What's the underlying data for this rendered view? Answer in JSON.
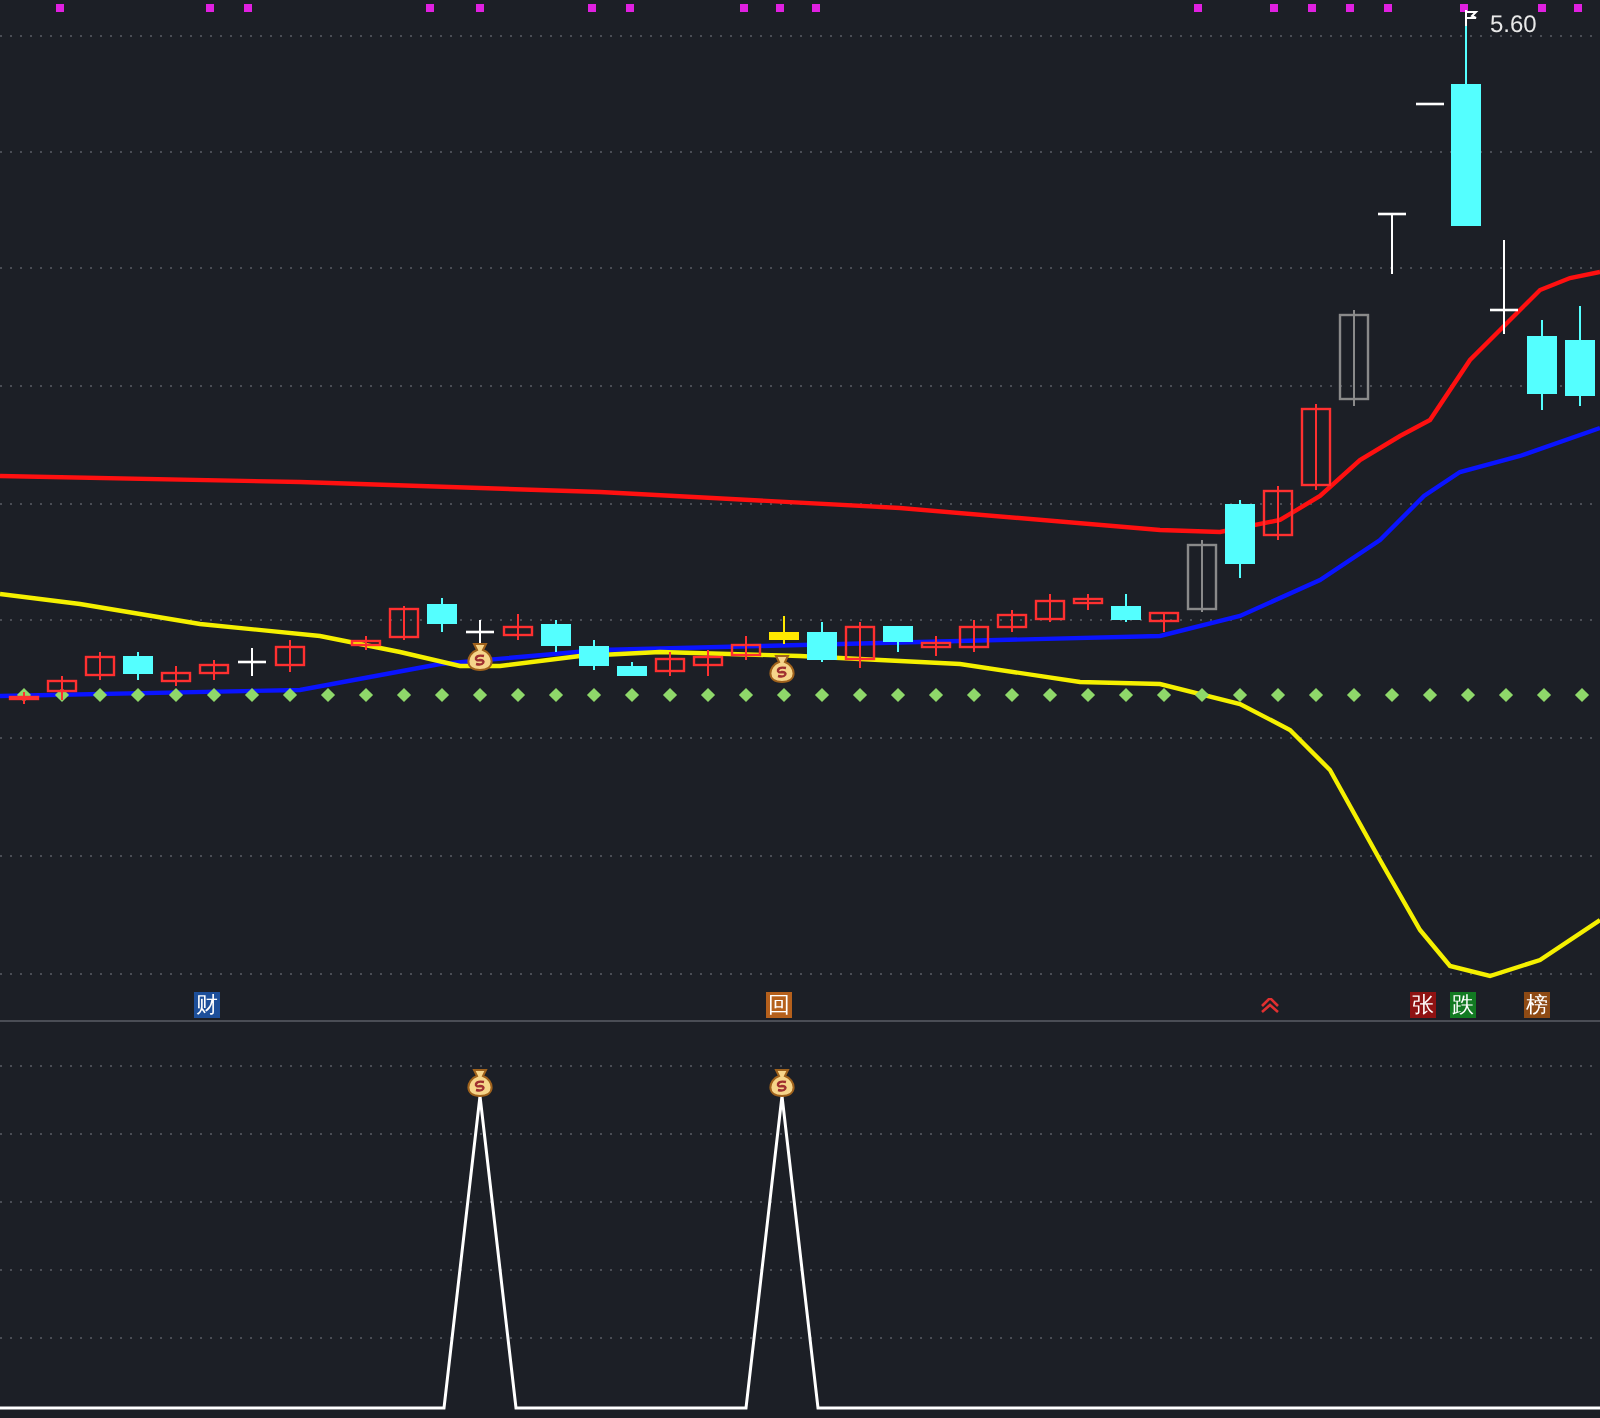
{
  "price_chart": {
    "high_label": "5.60"
  },
  "signal_markers": [
    {
      "kind": "badge",
      "text": "财",
      "color": "#1d4f9a"
    },
    {
      "kind": "badge",
      "text": "回",
      "color": "#b5601c"
    },
    {
      "kind": "arrow"
    },
    {
      "kind": "badge",
      "text": "张",
      "color": "#8e1212"
    },
    {
      "kind": "badge",
      "text": "跌",
      "color": "#127a22"
    },
    {
      "kind": "badge",
      "text": "榜",
      "color": "#8e4a14"
    }
  ]
}
